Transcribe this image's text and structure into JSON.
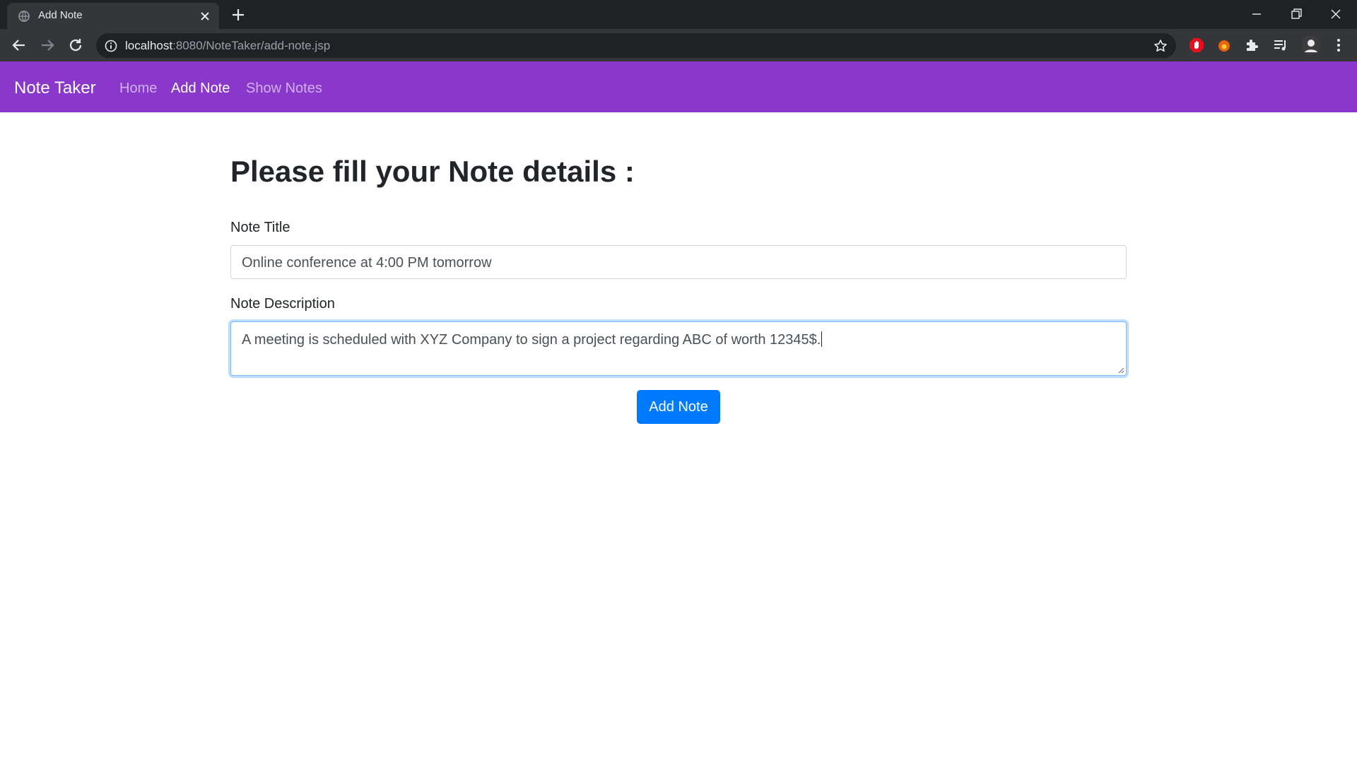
{
  "browser": {
    "tab_title": "Add Note",
    "url_host": "localhost",
    "url_path": ":8080/NoteTaker/add-note.jsp"
  },
  "navbar": {
    "brand": "Note Taker",
    "links": [
      {
        "label": "Home",
        "active": false
      },
      {
        "label": "Add Note",
        "active": true
      },
      {
        "label": "Show Notes",
        "active": false
      }
    ],
    "color": "#8a38cc"
  },
  "form": {
    "heading": "Please fill your Note details :",
    "title_label": "Note Title",
    "title_value": "Online conference at 4:00 PM tomorrow",
    "description_label": "Note Description",
    "description_value": "A meeting is scheduled with XYZ Company to sign a project regarding ABC of worth 12345$.",
    "submit_label": "Add Note",
    "accent": "#007bff"
  }
}
